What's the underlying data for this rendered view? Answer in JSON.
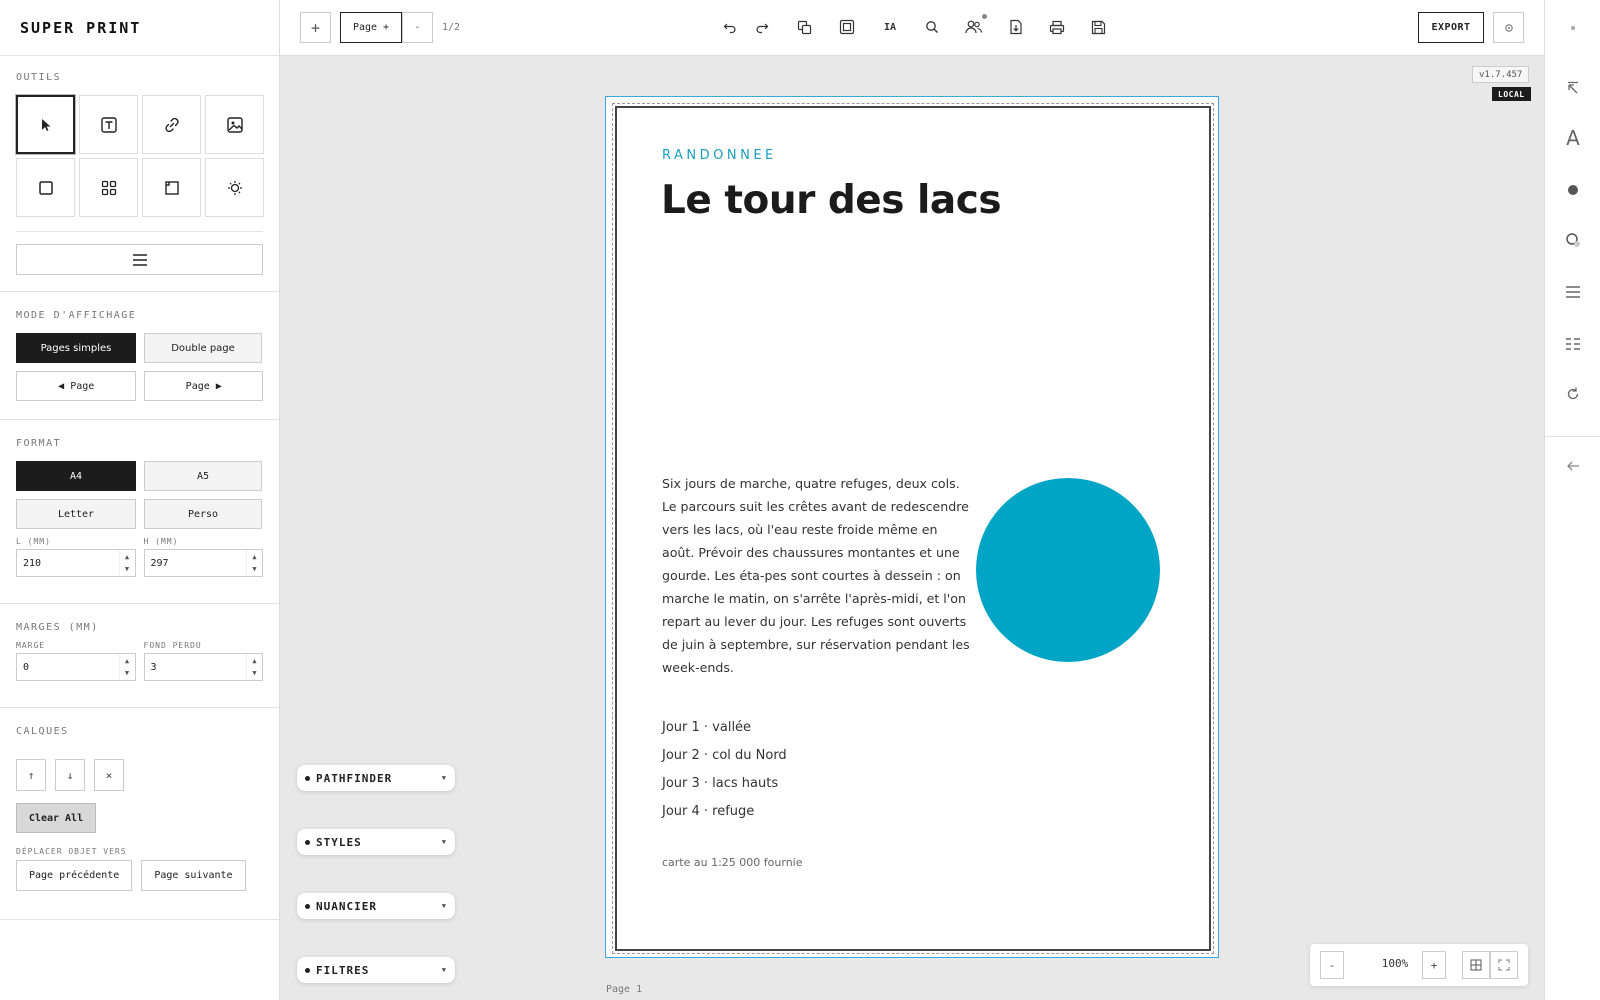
{
  "app": {
    "title": "SUPER PRINT",
    "version": "v1.7.457",
    "env_badge": "LOCAL"
  },
  "tools": {
    "title": "OUTILS",
    "items": [
      "select-icon",
      "text-box-icon",
      "link-icon",
      "image-icon",
      "rectangle-icon",
      "grid-icon",
      "frame-icon",
      "light-icon"
    ]
  },
  "display_mode": {
    "title": "MODE D'AFFICHAGE",
    "single": "Pages simples",
    "double": "Double page",
    "prev_page": "◀ Page",
    "next_page": "Page ▶"
  },
  "format": {
    "title": "FORMAT",
    "options": [
      "A4",
      "A5",
      "Letter",
      "Perso"
    ],
    "selected": "A4",
    "width_label": "L (MM)",
    "height_label": "H (MM)",
    "width_value": "210",
    "height_value": "297"
  },
  "margins": {
    "title": "MARGES (MM)",
    "margin_label": "MARGE",
    "bleed_label": "FOND PERDU",
    "margin_value": "0",
    "bleed_value": "3"
  },
  "layers": {
    "title": "CALQUES",
    "up": "↑",
    "down": "↓",
    "delete": "×",
    "clear_all": "Clear All",
    "move_label": "DÉPLACER OBJET VERS",
    "prev": "Page précédente",
    "next": "Page suivante"
  },
  "topbar": {
    "add": "+",
    "page_plus": "Page +",
    "minus": "-",
    "page_count": "1/2",
    "ai": "IA",
    "export": "EXPORT"
  },
  "document": {
    "kicker": "RANDONNEE",
    "headline": "Le tour des lacs",
    "body": "Six jours de marche, quatre refuges, deux cols. Le parcours suit les crêtes avant de redescendre vers les lacs, où l'eau reste froide même en août. Prévoir des chaussures montantes et une gourde. Les éta-pes sont courtes à dessein : on marche le matin, on s'arrête l'après-midi, et l'on repart au lever du jour. Les refuges sont ouverts de juin à septembre, sur réservation pendant les week-ends.",
    "days": [
      "Jour 1 · vallée",
      "Jour 2 · col du Nord",
      "Jour 3 · lacs hauts",
      "Jour 4 · refuge"
    ],
    "note": "carte au 1:25 000 fournie",
    "accent_color": "#00a5c6",
    "page_label": "Page 1"
  },
  "panels": [
    "PATHFINDER",
    "STYLES",
    "NUANCIER",
    "FILTRES"
  ],
  "zoom": {
    "minus": "-",
    "value": "100%",
    "plus": "+"
  }
}
